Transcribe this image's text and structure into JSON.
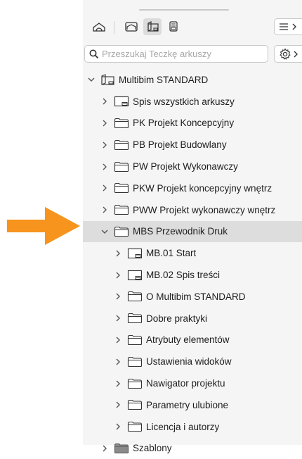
{
  "toolbar": {
    "buttons": [
      {
        "icon": "project-map-icon"
      },
      {
        "icon": "view-map-icon"
      },
      {
        "icon": "layout-book-icon",
        "active": true
      },
      {
        "icon": "publisher-sets-icon"
      }
    ],
    "menu_icon": "hamburger-menu-icon"
  },
  "search": {
    "placeholder": "Przeszukaj Teczkę arkuszy",
    "value": "",
    "settings_icon": "gear-icon"
  },
  "tree": {
    "root": {
      "label": "Multibim STANDARD",
      "expanded": true
    },
    "items": [
      {
        "label": "Spis wszystkich arkuszy",
        "type": "layout",
        "level": 1
      },
      {
        "label": "PK Projekt Koncepcyjny",
        "type": "folder",
        "level": 1
      },
      {
        "label": "PB Projekt Budowlany",
        "type": "folder",
        "level": 1
      },
      {
        "label": "PW Projekt Wykonawczy",
        "type": "folder",
        "level": 1
      },
      {
        "label": "PKW Projekt koncepcyjny wnętrz",
        "type": "folder",
        "level": 1
      },
      {
        "label": "PWW Projekt wykonawczy wnętrz",
        "type": "folder",
        "level": 1
      },
      {
        "label": "MBS Przewodnik Druk",
        "type": "folder",
        "level": 1,
        "expanded": true,
        "selected": true
      },
      {
        "label": "MB.01 Start",
        "type": "layout",
        "level": 2
      },
      {
        "label": "MB.02 Spis treści",
        "type": "layout",
        "level": 2
      },
      {
        "label": "O Multibim STANDARD",
        "type": "folder",
        "level": 2
      },
      {
        "label": "Dobre praktyki",
        "type": "folder",
        "level": 2
      },
      {
        "label": "Atrybuty elementów",
        "type": "folder",
        "level": 2
      },
      {
        "label": "Ustawienia widoków",
        "type": "folder",
        "level": 2
      },
      {
        "label": "Nawigator projektu",
        "type": "folder",
        "level": 2
      },
      {
        "label": "Parametry ulubione",
        "type": "folder",
        "level": 2
      },
      {
        "label": "Licencja i autorzy",
        "type": "folder",
        "level": 2
      },
      {
        "label": "Szablony",
        "type": "folder-dark",
        "level": 1
      }
    ]
  },
  "colors": {
    "arrow": "#f7941d",
    "selection": "#dddddd",
    "panel_bg": "#f5f5f5"
  }
}
